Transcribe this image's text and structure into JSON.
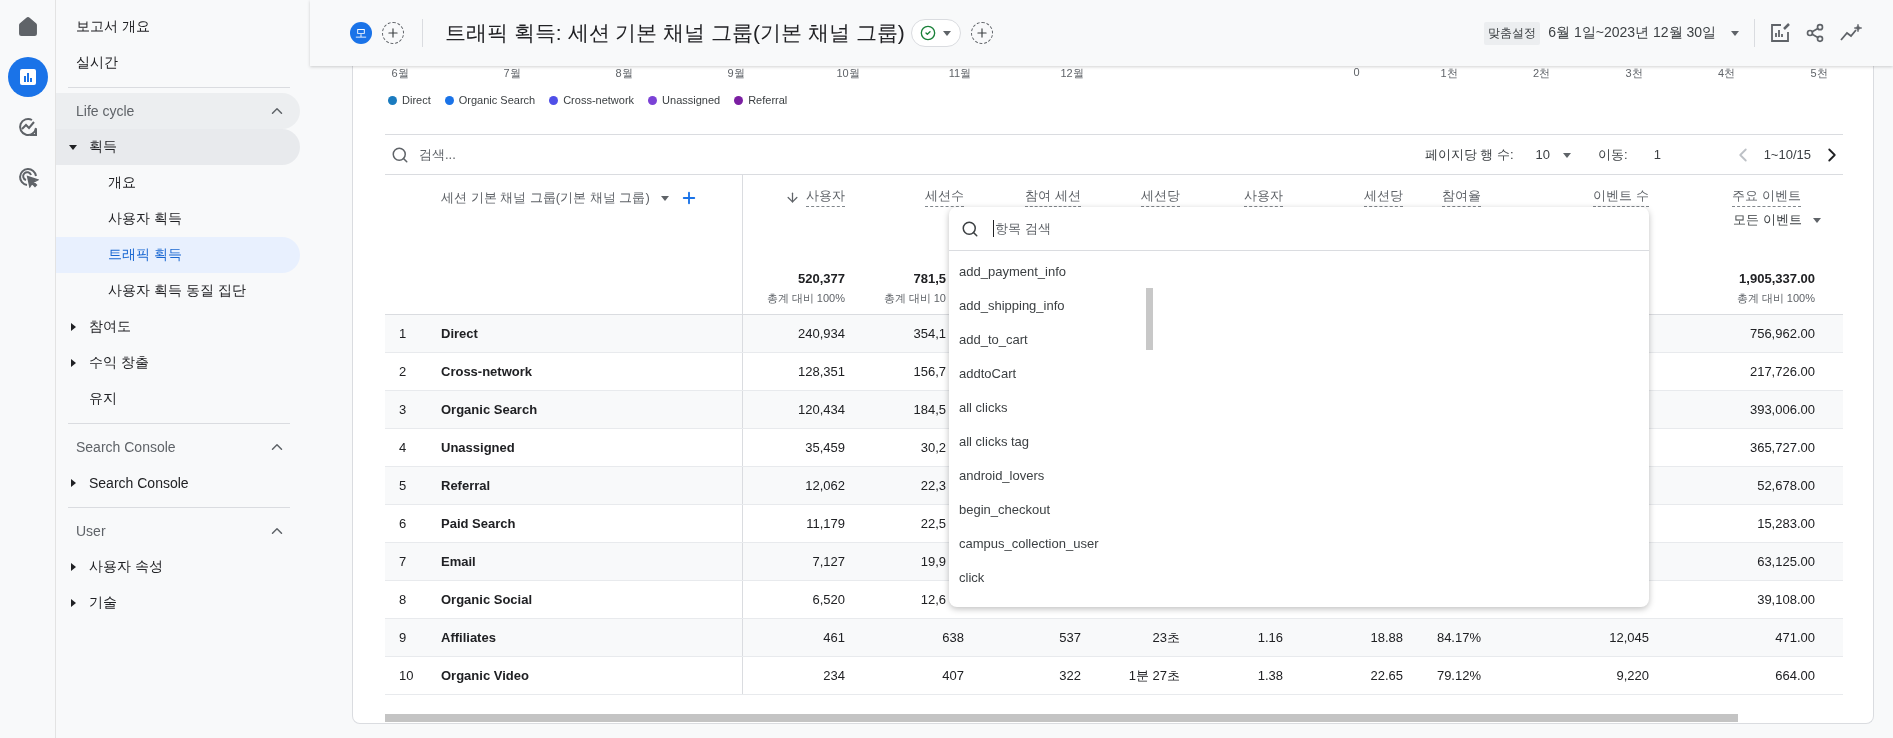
{
  "rail": [
    {
      "kind": "home",
      "selected": false
    },
    {
      "kind": "reports",
      "selected": true
    },
    {
      "kind": "explore",
      "selected": false
    },
    {
      "kind": "advertising",
      "selected": false
    }
  ],
  "sidebar": {
    "links": [
      {
        "label": "보고서 개요",
        "selected": false
      },
      {
        "label": "실시간",
        "selected": false
      }
    ],
    "sections": [
      {
        "title": "Life cycle",
        "expanded": true,
        "highlighted": true,
        "items": [
          {
            "kind": "group",
            "label": "획득",
            "expanded": true,
            "highlighted": true,
            "children": [
              {
                "label": "개요",
                "selected": false
              },
              {
                "label": "사용자 획득",
                "selected": false
              },
              {
                "label": "트래픽 획득",
                "selected": true
              },
              {
                "label": "사용자 획득 동질 집단",
                "selected": false
              }
            ]
          },
          {
            "kind": "group",
            "label": "참여도",
            "expanded": false,
            "highlighted": false
          },
          {
            "kind": "group",
            "label": "수익 창출",
            "expanded": false,
            "highlighted": false
          },
          {
            "kind": "link",
            "label": "유지"
          }
        ]
      },
      {
        "title": "Search Console",
        "expanded": true,
        "highlighted": false,
        "items": [
          {
            "kind": "group",
            "label": "Search Console",
            "expanded": false,
            "highlighted": false
          }
        ]
      },
      {
        "title": "User",
        "expanded": true,
        "highlighted": false,
        "items": [
          {
            "kind": "group",
            "label": "사용자 속성",
            "expanded": false,
            "highlighted": false
          },
          {
            "kind": "group",
            "label": "기술",
            "expanded": false,
            "highlighted": false
          }
        ]
      }
    ]
  },
  "header": {
    "avatar": "모",
    "title": "트래픽 획득: 세션 기본 채널 그룹(기본 채널 그룹)",
    "custom_badge": "맞춤설정",
    "date_range": "6월 1일~2023년 12월 30일"
  },
  "chart": {
    "x_labels": [
      "6월",
      "7월",
      "8월",
      "9월",
      "10월",
      "11월",
      "12월"
    ],
    "y_labels": [
      "0",
      "1천",
      "2천",
      "3천",
      "4천",
      "5천"
    ],
    "legend": [
      {
        "label": "Direct",
        "color": "#1a7bbf"
      },
      {
        "label": "Organic Search",
        "color": "#1a73e8"
      },
      {
        "label": "Cross-network",
        "color": "#4f4fe8"
      },
      {
        "label": "Unassigned",
        "color": "#7b42d6"
      },
      {
        "label": "Referral",
        "color": "#7b1fa2"
      }
    ]
  },
  "toolbar": {
    "search": {
      "placeholder": "검색..."
    },
    "rows_per_page_label": "페이지당 행 수:",
    "rows_per_page": "10",
    "goto_label": "이동:",
    "goto_value": "1",
    "range": "1~10/15"
  },
  "table": {
    "dimension_header": "세션 기본 채널 그룹(기본 채널 그룹)",
    "columns": [
      {
        "label": "사용자",
        "sorted": true
      },
      {
        "label": "세션수",
        "sorted": false
      },
      {
        "label": "참여 세션",
        "sorted": false
      },
      {
        "label": "세션당",
        "sorted": false
      },
      {
        "label": "사용자",
        "sorted": false
      },
      {
        "label": "세션당",
        "sorted": false
      },
      {
        "label": "참여율",
        "sorted": false
      },
      {
        "label": "이벤트 수",
        "sorted": false
      },
      {
        "label": "주요 이벤트",
        "sorted": false,
        "filter": "모든 이벤트"
      }
    ],
    "totals": {
      "values": [
        {
          "value": "520,377",
          "share": "총계 대비 100%"
        },
        {
          "value": "781,5",
          "share": "총계 대비 10"
        }
      ],
      "key_events": {
        "value": "1,905,337.00",
        "share": "총계 대비 100%"
      }
    },
    "rows": [
      {
        "rank": "1",
        "channel": "Direct",
        "values": [
          "240,934",
          "354,1"
        ],
        "key_events": "756,962.00"
      },
      {
        "rank": "2",
        "channel": "Cross-network",
        "values": [
          "128,351",
          "156,7"
        ],
        "key_events": "217,726.00"
      },
      {
        "rank": "3",
        "channel": "Organic Search",
        "values": [
          "120,434",
          "184,5"
        ],
        "key_events": "393,006.00"
      },
      {
        "rank": "4",
        "channel": "Unassigned",
        "values": [
          "35,459",
          "30,2"
        ],
        "key_events": "365,727.00"
      },
      {
        "rank": "5",
        "channel": "Referral",
        "values": [
          "12,062",
          "22,3"
        ],
        "key_events": "52,678.00"
      },
      {
        "rank": "6",
        "channel": "Paid Search",
        "values": [
          "11,179",
          "22,5"
        ],
        "key_events": "15,283.00"
      },
      {
        "rank": "7",
        "channel": "Email",
        "values": [
          "7,127",
          "19,9"
        ],
        "key_events": "63,125.00"
      },
      {
        "rank": "8",
        "channel": "Organic Social",
        "values": [
          "6,520",
          "12,6"
        ],
        "key_events": "39,108.00"
      },
      {
        "rank": "9",
        "channel": "Affiliates",
        "values": [
          "461",
          "638",
          "537",
          "23초",
          "1.16",
          "18.88",
          "84.17%",
          "12,045"
        ],
        "key_events": "471.00"
      },
      {
        "rank": "10",
        "channel": "Organic Video",
        "values": [
          "234",
          "407",
          "322",
          "1분 27초",
          "1.38",
          "22.65",
          "79.12%",
          "9,220"
        ],
        "key_events": "664.00"
      }
    ]
  },
  "dropdown": {
    "placeholder": "항목 검색",
    "items": [
      "add_payment_info",
      "add_shipping_info",
      "add_to_cart",
      "addtoCart",
      "all clicks",
      "all clicks tag",
      "android_lovers",
      "begin_checkout",
      "campus_collection_user",
      "click"
    ]
  }
}
